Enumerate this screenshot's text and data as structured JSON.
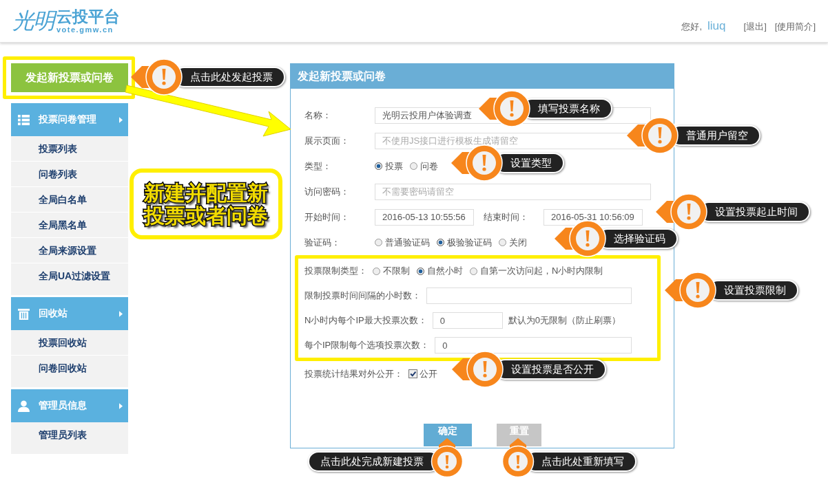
{
  "header": {
    "logo_mark": "光明",
    "logo_title": "云投平台",
    "logo_domain": "vote.gmw.cn",
    "greeting": "您好,",
    "username": "liuq",
    "links": [
      "[退出]",
      "[使用简介]"
    ]
  },
  "new_button": "发起新投票或问卷",
  "sidebar": [
    {
      "title": "投票问卷管理",
      "items": [
        "投票列表",
        "问卷列表",
        "全局白名单",
        "全局黑名单",
        "全局来源设置",
        "全局UA过滤设置"
      ]
    },
    {
      "title": "回收站",
      "items": [
        "投票回收站",
        "问卷回收站"
      ]
    },
    {
      "title": "管理员信息",
      "items": [
        "管理员列表"
      ]
    }
  ],
  "banner": [
    "新建并配置新",
    "投票或者问卷"
  ],
  "form": {
    "title": "发起新投票或问卷",
    "rows": [
      {
        "kind": "input",
        "label": "名称：",
        "value": "光明云投用户体验调查"
      },
      {
        "kind": "input",
        "label": "展示页面：",
        "placeholder": "不使用JS接口进行模板生成请留空"
      },
      {
        "kind": "radio",
        "label": "类型：",
        "options": [
          {
            "label": "投票",
            "selected": true
          },
          {
            "label": "问卷",
            "selected": false
          }
        ]
      },
      {
        "kind": "input",
        "label": "访问密码：",
        "placeholder": "不需要密码请留空"
      },
      {
        "kind": "range",
        "label": "开始时间：",
        "value": "2016-05-13 10:55:56",
        "label2": "结束时间：",
        "value2": "2016-05-31 10:56:09"
      },
      {
        "kind": "radio",
        "label": "验证码：",
        "options": [
          {
            "label": "普通验证码",
            "selected": false
          },
          {
            "label": "极验验证码",
            "selected": true
          },
          {
            "label": "关闭",
            "selected": false
          }
        ]
      }
    ],
    "limits": [
      {
        "kind": "radio",
        "label": "投票限制类型：",
        "options": [
          {
            "label": "不限制",
            "selected": false
          },
          {
            "label": "自然小时",
            "selected": true
          },
          {
            "label": "自第一次访问起，N小时内限制",
            "selected": false
          }
        ]
      },
      {
        "kind": "input",
        "label": "限制投票时间间隔的小时数："
      },
      {
        "kind": "short",
        "label": "N小时内每个IP最大投票次数：",
        "value": "0",
        "note": "默认为0无限制（防止刷票）"
      },
      {
        "kind": "input",
        "label": "每个IP限制每个选项投票次数：",
        "value": "0"
      }
    ],
    "public": {
      "label": "投票统计结果对外公开：",
      "option": "公开",
      "checked": true
    },
    "buttons": [
      {
        "label": "确定",
        "kind": "primary"
      },
      {
        "label": "重置",
        "kind": "secondary"
      }
    ]
  },
  "callouts": [
    "点击此处发起投票",
    "填写投票名称",
    "普通用户留空",
    "设置类型",
    "设置投票起止时间",
    "选择验证码",
    "设置投票限制",
    "设置投票是否公开",
    "点击此处完成新建投票",
    "点击此处重新填写"
  ]
}
